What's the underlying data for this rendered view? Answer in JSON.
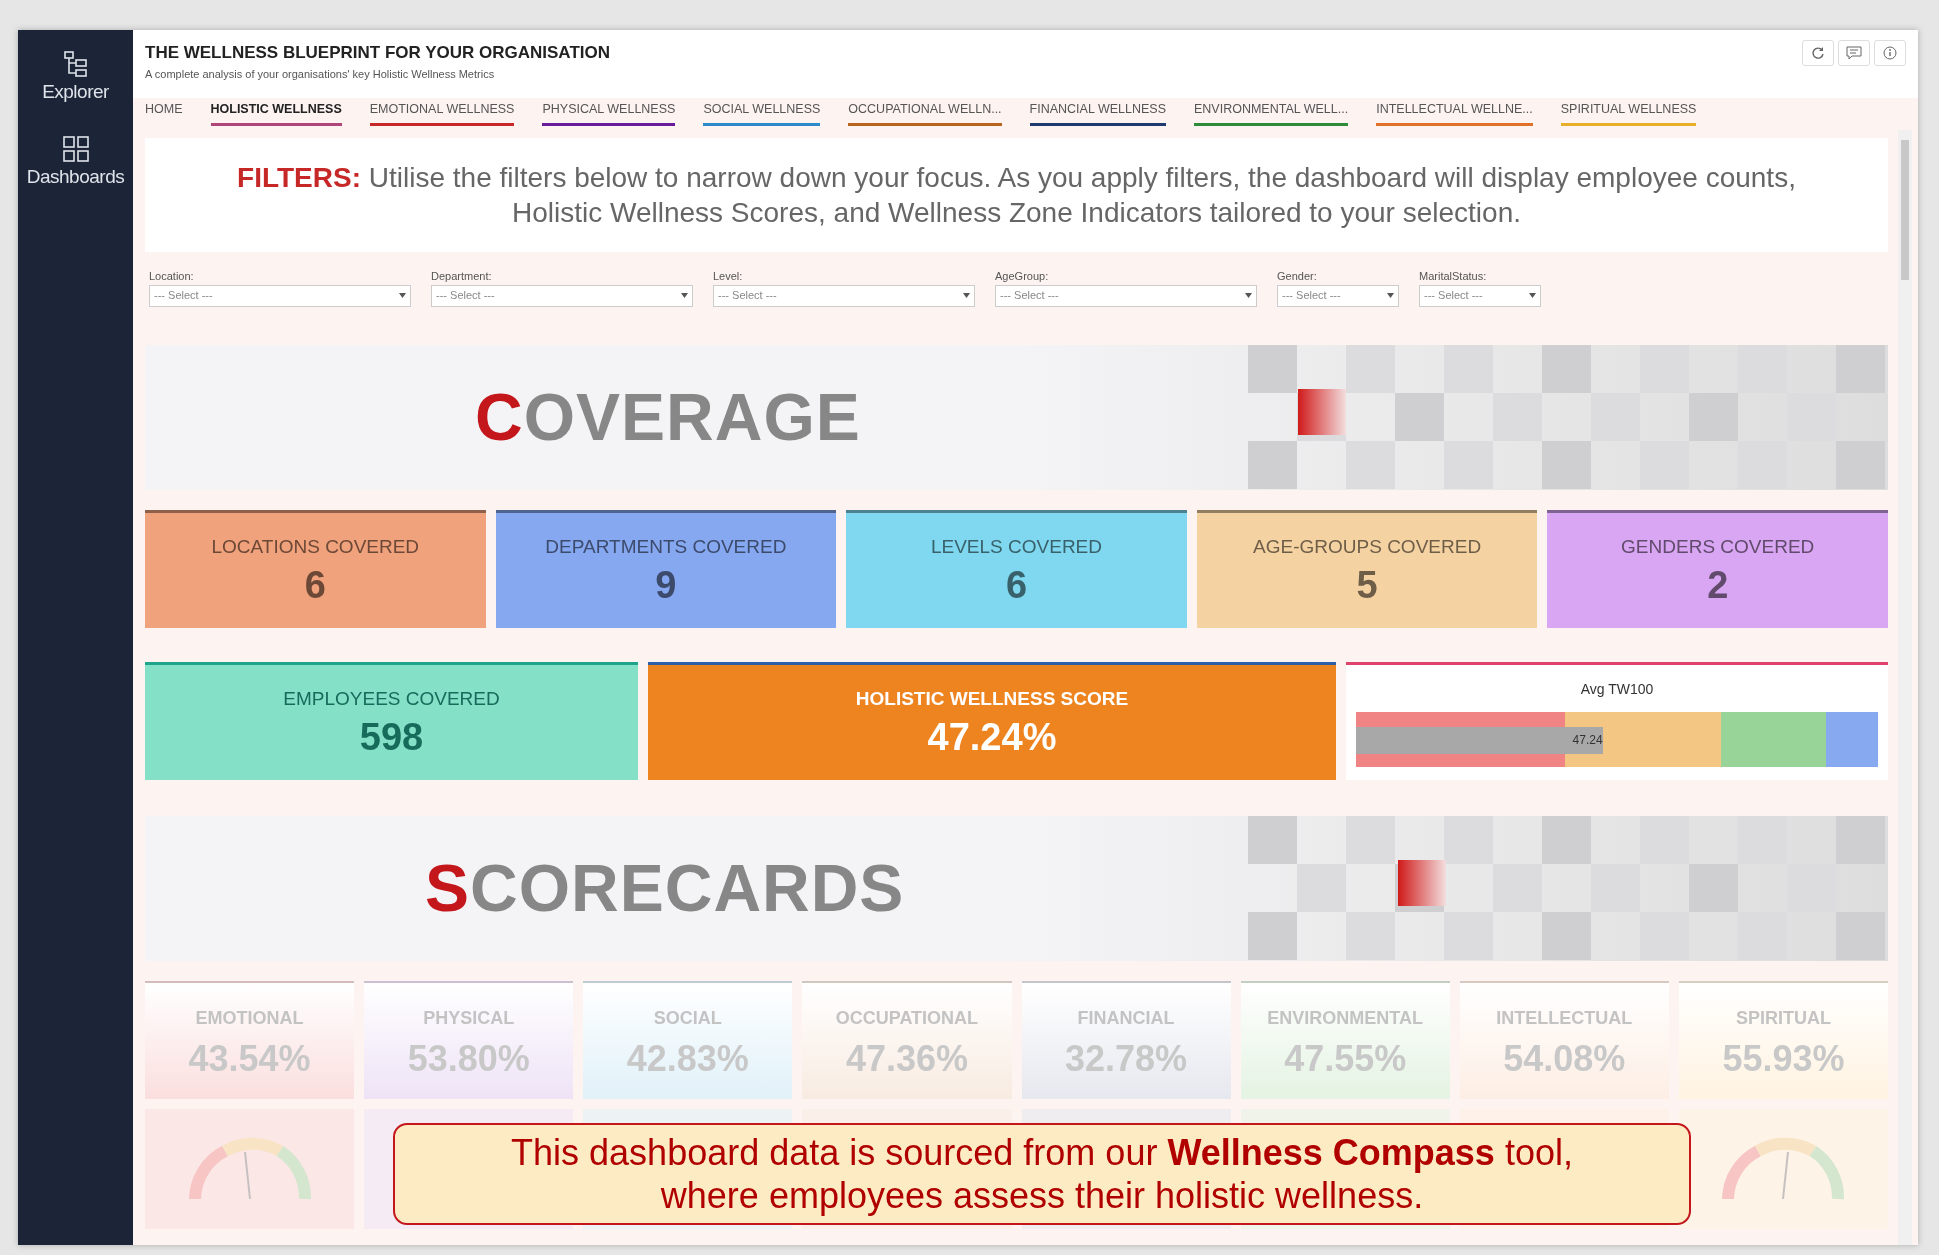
{
  "sidebar": {
    "items": [
      {
        "label": "Explorer",
        "kind": "explorer"
      },
      {
        "label": "Dashboards",
        "kind": "dashboards"
      }
    ]
  },
  "header": {
    "title": "THE WELLNESS BLUEPRINT FOR YOUR ORGANISATION",
    "subtitle": "A complete analysis of your organisations' key Holistic Wellness Metrics"
  },
  "tabs": [
    {
      "label": "HOME",
      "selected": false
    },
    {
      "label": "HOLISTIC WELLNESS",
      "selected": true,
      "color": "#b0457a"
    },
    {
      "label": "EMOTIONAL WELLNESS",
      "selected": false,
      "color": "#c62828"
    },
    {
      "label": "PHYSICAL WELLNESS",
      "selected": false,
      "color": "#6a1b9a"
    },
    {
      "label": "SOCIAL WELLNESS",
      "selected": false,
      "color": "#2e8bc9"
    },
    {
      "label": "OCCUPATIONAL WELLN...",
      "selected": false,
      "color": "#b8651e"
    },
    {
      "label": "FINANCIAL WELLNESS",
      "selected": false,
      "color": "#1f3a6e"
    },
    {
      "label": "ENVIRONMENTAL WELL...",
      "selected": false,
      "color": "#2e8b3a"
    },
    {
      "label": "INTELLECTUAL WELLNE...",
      "selected": false,
      "color": "#e0702a"
    },
    {
      "label": "SPIRITUAL WELLNESS",
      "selected": false,
      "color": "#e8b02a"
    }
  ],
  "filters_note": "**FILTERS:** Utilise the filters below to narrow down your focus. As you apply filters, the dashboard will display employee counts, Holistic Wellness Scores, and Wellness Zone Indicators tailored to your selection.",
  "filters": [
    {
      "label": "Location:",
      "value": "--- Select ---",
      "kind": "wide"
    },
    {
      "label": "Department:",
      "value": "--- Select ---",
      "kind": "wide"
    },
    {
      "label": "Level:",
      "value": "--- Select ---",
      "kind": "wide"
    },
    {
      "label": "AgeGroup:",
      "value": "--- Select ---",
      "kind": "wide"
    },
    {
      "label": "Gender:",
      "value": "--- Select ---",
      "kind": "narrow"
    },
    {
      "label": "MaritalStatus:",
      "value": "--- Select ---",
      "kind": "narrow"
    }
  ],
  "coverage": {
    "title": "COVERAGE",
    "cards": [
      {
        "label": "LOCATIONS COVERED",
        "value": "6",
        "color": "#f0a27c"
      },
      {
        "label": "DEPARTMENTS COVERED",
        "value": "9",
        "color": "#86a8f0"
      },
      {
        "label": "LEVELS COVERED",
        "value": "6",
        "color": "#7fd8ef"
      },
      {
        "label": "AGE-GROUPS COVERED",
        "value": "5",
        "color": "#f5d2a2"
      },
      {
        "label": "GENDERS COVERED",
        "value": "2",
        "color": "#d8a6f2"
      }
    ]
  },
  "summary": {
    "employees": {
      "label": "EMPLOYEES COVERED",
      "value": "598"
    },
    "score": {
      "label": "HOLISTIC WELLNESS SCORE",
      "value": "47.24%"
    },
    "avg": {
      "title": "Avg TW100",
      "reading": "47.24",
      "level": 0.4724
    }
  },
  "scorecards": {
    "title": "SCORECARDS",
    "tiles": [
      {
        "label": "EMOTIONAL",
        "value": "43.54%",
        "color": "#fbdede"
      },
      {
        "label": "PHYSICAL",
        "value": "53.80%",
        "color": "#eee3f6"
      },
      {
        "label": "SOCIAL",
        "value": "42.83%",
        "color": "#e0f1f8"
      },
      {
        "label": "OCCUPATIONAL",
        "value": "47.36%",
        "color": "#f8ebe1"
      },
      {
        "label": "FINANCIAL",
        "value": "32.78%",
        "color": "#e6e8ef"
      },
      {
        "label": "ENVIRONMENTAL",
        "value": "47.55%",
        "color": "#e4f3e2"
      },
      {
        "label": "INTELLECTUAL",
        "value": "54.08%",
        "color": "#fdeee4"
      },
      {
        "label": "SPIRITUAL",
        "value": "55.93%",
        "color": "#fff3e0"
      }
    ]
  },
  "note": "This dashboard data is sourced from our **Wellness Compass** tool, where employees assess their holistic wellness."
}
